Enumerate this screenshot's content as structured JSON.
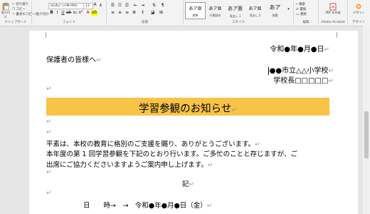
{
  "ribbon": {
    "clipboard": {
      "paste": "貼り付け",
      "cut": "切り取り",
      "copy": "コピー",
      "format_painter": "書式のコピー/貼り付け",
      "group": "クリップボード"
    },
    "font": {
      "name": "HG丸ｺﾞｼｯｸM-PRO",
      "size": "13",
      "group": "フォント"
    },
    "paragraph": {
      "group": "段落"
    },
    "styles": {
      "group": "スタイル",
      "items": [
        {
          "preview": "あア亜",
          "label": "標準"
        },
        {
          "preview": "あア亜",
          "label": "行間詰め"
        },
        {
          "preview": "あア亜",
          "label": "見出し 1"
        },
        {
          "preview": "あア亜",
          "label": "見出し 2"
        },
        {
          "preview": "あア",
          "label": "表題"
        }
      ]
    },
    "editing": {
      "group": "編集",
      "find": "検索",
      "replace": "置換",
      "select": "選択"
    },
    "acrobat": {
      "label": "PDF を作成",
      "group": "Adobe Acrobat"
    },
    "design": {
      "label": "デザイン",
      "group": "デザイン"
    }
  },
  "document": {
    "date": "令和●年●月●日",
    "recipient": "保護者の皆様へ",
    "sender_school": "●●市立△△小学校",
    "sender_principal": "学校長□□□□□",
    "title": "学習参観のお知らせ",
    "body_line1": "平素は、本校の教育に格別のご支援を賜り、ありがとうございます。",
    "body_line2": "本年度の第 1 回学習参観を下記のとおり行います。ご多忙のことと存じますが、ご",
    "body_line3": "出席にご協力くださいますようご案内申し上げます。",
    "ki": "記",
    "schedule_label": "日　　時→　→　令和●年●月●日（金）"
  }
}
